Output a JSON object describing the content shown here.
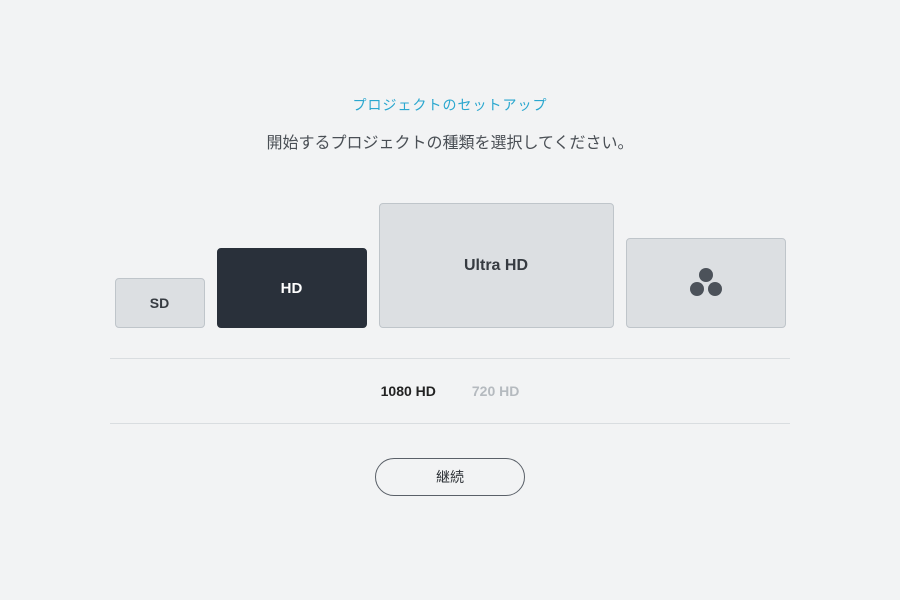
{
  "header": {
    "eyebrow": "プロジェクトのセットアップ",
    "subtitle": "開始するプロジェクトの種類を選択してください。"
  },
  "tiles": {
    "sd": {
      "label": "SD"
    },
    "hd": {
      "label": "HD",
      "selected": true
    },
    "uhd": {
      "label": "Ultra HD"
    },
    "custom": {
      "icon": "custom-resolution-icon"
    }
  },
  "subopts": {
    "opt1080": {
      "label": "1080 HD",
      "active": true
    },
    "opt720": {
      "label": "720 HD",
      "active": false
    }
  },
  "actions": {
    "continue_label": "継続"
  }
}
